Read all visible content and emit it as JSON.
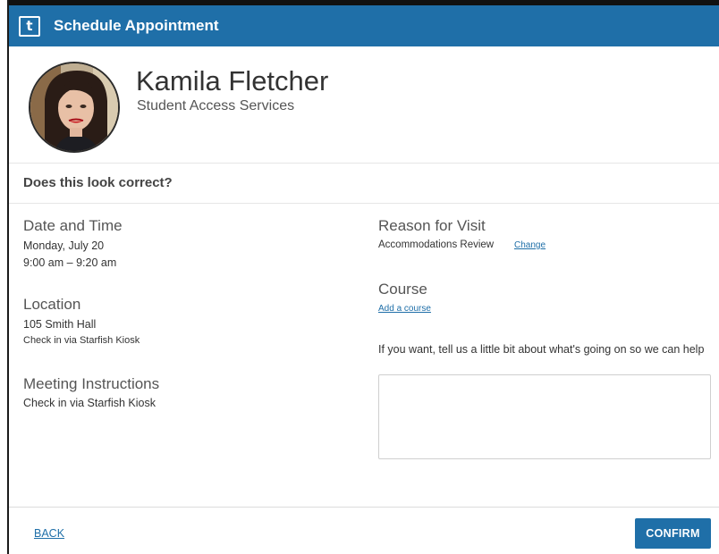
{
  "header": {
    "logo_glyph": "t",
    "title": "Schedule Appointment"
  },
  "advisor": {
    "name": "Kamila Fletcher",
    "department": "Student Access Services"
  },
  "confirm_heading": "Does this look correct?",
  "date_time": {
    "title": "Date and Time",
    "date": "Monday, July 20",
    "time": "9:00 am – 9:20 am"
  },
  "location": {
    "title": "Location",
    "place": "105 Smith Hall",
    "note": "Check in via Starfish Kiosk"
  },
  "meeting_instructions": {
    "title": "Meeting Instructions",
    "text": "Check in via Starfish Kiosk"
  },
  "reason": {
    "title": "Reason for Visit",
    "value": "Accommodations Review",
    "change_label": "Change"
  },
  "course": {
    "title": "Course",
    "add_label": "Add a course"
  },
  "notes": {
    "label": "If you want, tell us a little bit about what's going on so we can help",
    "value": ""
  },
  "footer": {
    "back_label": "BACK",
    "confirm_label": "CONFIRM"
  },
  "colors": {
    "brand": "#1f6fa8",
    "frame": "#1b1b1b"
  }
}
